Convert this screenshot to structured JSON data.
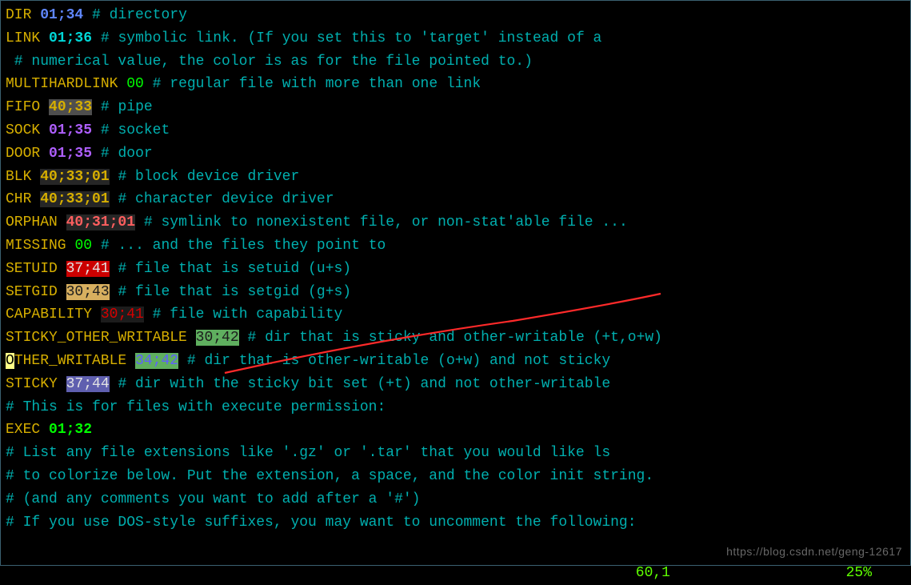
{
  "lines": {
    "l1": {
      "key": "DIR",
      "val": "01;34",
      "comment": "# directory"
    },
    "l2": {
      "key": "LINK",
      "val": "01;36",
      "comment": "# symbolic link. (If you set this to 'target' instead of a"
    },
    "l2b": {
      "comment": " # numerical value, the color is as for the file pointed to.)"
    },
    "l3": {
      "key": "MULTIHARDLINK",
      "val": "00",
      "comment": "# regular file with more than one link"
    },
    "l4": {
      "key": "FIFO",
      "val": "40;33",
      "comment": "# pipe"
    },
    "l5": {
      "key": "SOCK",
      "val": "01;35",
      "comment": "# socket"
    },
    "l6": {
      "key": "DOOR",
      "val": "01;35",
      "comment": "# door"
    },
    "l7": {
      "key": "BLK",
      "val": "40;33;01",
      "comment": "# block device driver"
    },
    "l8": {
      "key": "CHR",
      "val": "40;33;01",
      "comment": "# character device driver"
    },
    "l9": {
      "key": "ORPHAN",
      "val": "40;31;01",
      "comment": "# symlink to nonexistent file, or non-stat'able file ..."
    },
    "l10": {
      "key": "MISSING",
      "val": "00",
      "comment": "# ... and the files they point to"
    },
    "l11": {
      "key": "SETUID",
      "val": "37;41",
      "comment": "# file that is setuid (u+s)"
    },
    "l12": {
      "key": "SETGID",
      "val": "30;43",
      "comment": "# file that is setgid (g+s)"
    },
    "l13": {
      "key": "CAPABILITY",
      "val": "30;41",
      "comment": "# file with capability"
    },
    "l14": {
      "key": "STICKY_OTHER_WRITABLE",
      "val": "30;42",
      "comment": "# dir that is sticky and other-writable (+t,o+w)"
    },
    "l15": {
      "key_o": "O",
      "key_rest": "THER_WRITABLE",
      "val": "34;42",
      "comment": "# dir that is other-writable (o+w) and not sticky"
    },
    "l16": {
      "key": "STICKY",
      "val": "37;44",
      "comment": "# dir with the sticky bit set (+t) and not other-writable"
    },
    "l17": {
      "comment": "# This is for files with execute permission:"
    },
    "l18": {
      "key": "EXEC",
      "val": "01;32"
    },
    "l19": {
      "comment": "# List any file extensions like '.gz' or '.tar' that you would like ls"
    },
    "l20": {
      "comment": "# to colorize below. Put the extension, a space, and the color init string."
    },
    "l21": {
      "comment": "# (and any comments you want to add after a '#')"
    },
    "l22": {
      "comment": "# If you use DOS-style suffixes, you may want to uncomment the following:"
    }
  },
  "status": {
    "pos": "60,1",
    "pct": "25%"
  },
  "watermark": "https://blog.csdn.net/geng-12617"
}
